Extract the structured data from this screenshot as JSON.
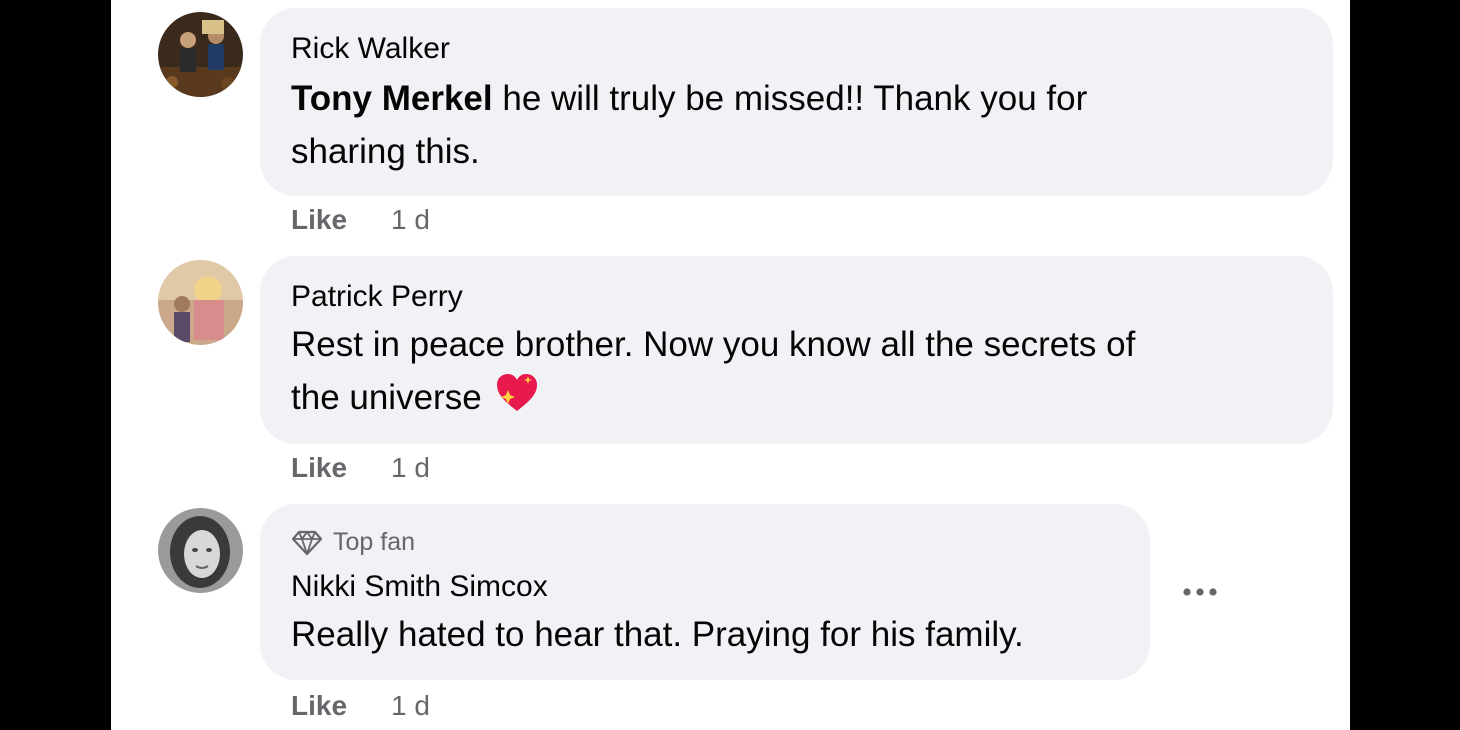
{
  "comments": [
    {
      "author": "Rick Walker",
      "tagged_name": "Tony Merkel",
      "text_line1": " he will truly be missed!! Thank you for",
      "text_line2": "sharing this.",
      "like_label": "Like",
      "time": "1 d",
      "avatar_icon": "profile-photo"
    },
    {
      "author": "Patrick Perry",
      "text_line1": "Rest in peace brother. Now you know all the secrets of",
      "text_line2": "the universe",
      "emoji": "sparkling-heart-icon",
      "like_label": "Like",
      "time": "1 d",
      "avatar_icon": "profile-photo"
    },
    {
      "badge": "Top fan",
      "badge_icon": "diamond-icon",
      "author": "Nikki Smith Simcox",
      "text_line1": "Really hated to hear that. Praying for his family.",
      "like_label": "Like",
      "time": "1 d",
      "avatar_icon": "profile-photo",
      "more_icon": "more-options-icon"
    }
  ],
  "colors": {
    "bubble": "#f0f2f5",
    "text": "#050505",
    "secondary": "#65676b",
    "backdrop": "#000000",
    "heart": "#e8194c"
  }
}
